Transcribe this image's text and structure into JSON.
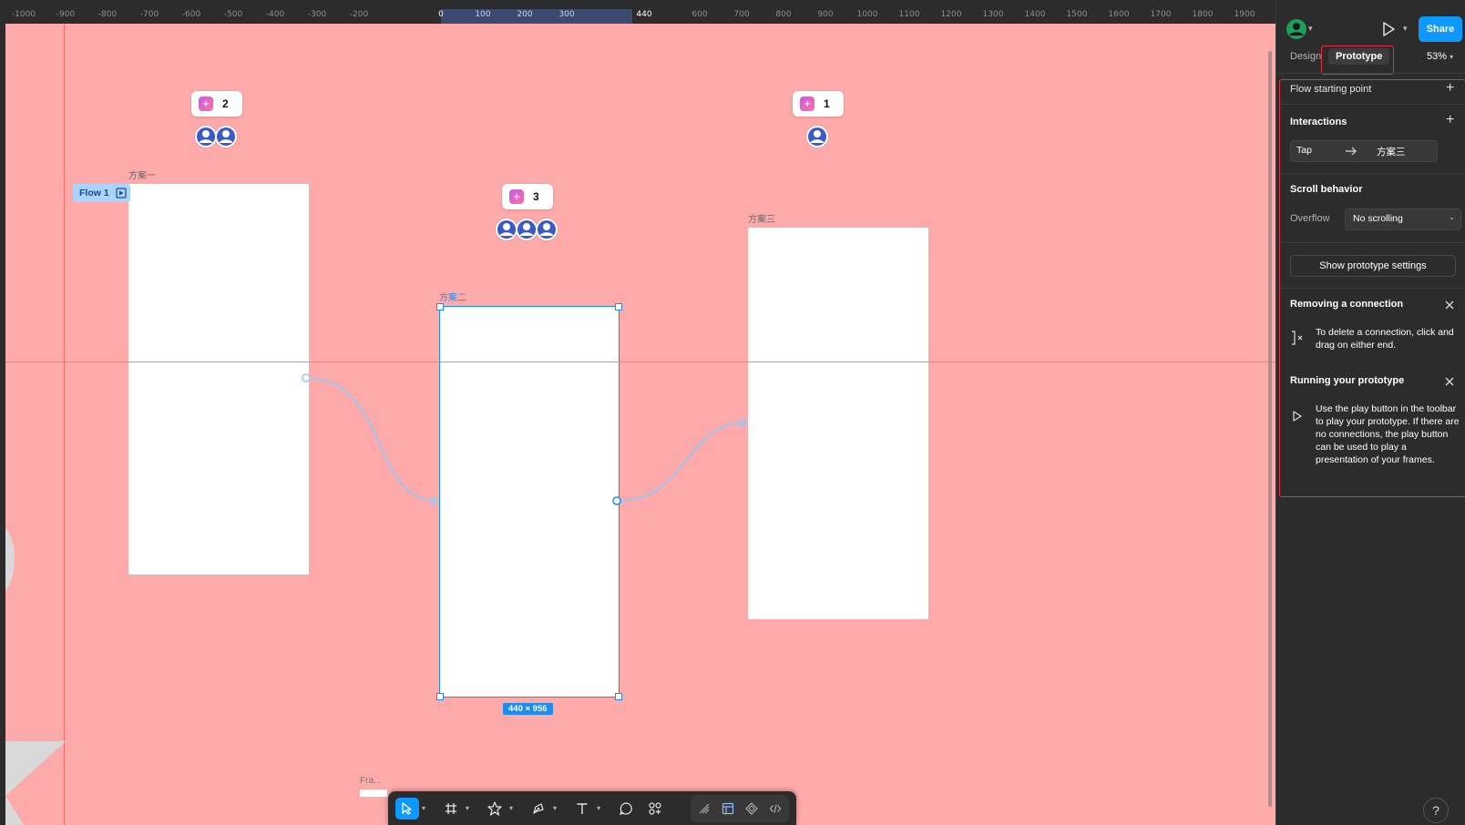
{
  "ruler": {
    "ticks": [
      "-1000",
      "-900",
      "-800",
      "-700",
      "-600",
      "-500",
      "-400",
      "-300",
      "-200",
      "0",
      "100",
      "200",
      "300",
      "440",
      "600",
      "700",
      "800",
      "900",
      "1000",
      "1100",
      "1200",
      "1300",
      "1400",
      "1500",
      "1600",
      "1700",
      "1800",
      "1900"
    ]
  },
  "canvas": {
    "frames": [
      {
        "label": "方案一"
      },
      {
        "label": "方案二"
      },
      {
        "label": "方案三"
      }
    ],
    "flow_chip": {
      "label": "Flow 1"
    },
    "size_chip": {
      "label": "440 × 956"
    },
    "comments": [
      {
        "count": "2"
      },
      {
        "count": "3"
      },
      {
        "count": "1"
      }
    ],
    "frame_tool_label": "Fra..."
  },
  "sidebar": {
    "share_label": "Share",
    "tabs": [
      {
        "label": "Design"
      },
      {
        "label": "Prototype"
      }
    ],
    "zoom": "53%",
    "flow_starting_point": "Flow starting point",
    "interactions": {
      "title": "Interactions",
      "trigger": "Tap",
      "destination": "方案三"
    },
    "scroll_behavior": {
      "title": "Scroll behavior",
      "overflow_label": "Overflow",
      "overflow_value": "No scrolling"
    },
    "show_settings": "Show prototype settings",
    "removing": {
      "title": "Removing a connection",
      "body": "To delete a connection, click and drag on either end."
    },
    "running": {
      "title": "Running your prototype",
      "body": "Use the play button in the toolbar to play your prototype. If there are no connections, the play button can be used to play a presentation of your frames."
    },
    "help": "?"
  },
  "colors": {
    "canvas_bg": "#ffaaaa",
    "accent": "#0d99ff",
    "highlight_red": "#e0333f"
  }
}
